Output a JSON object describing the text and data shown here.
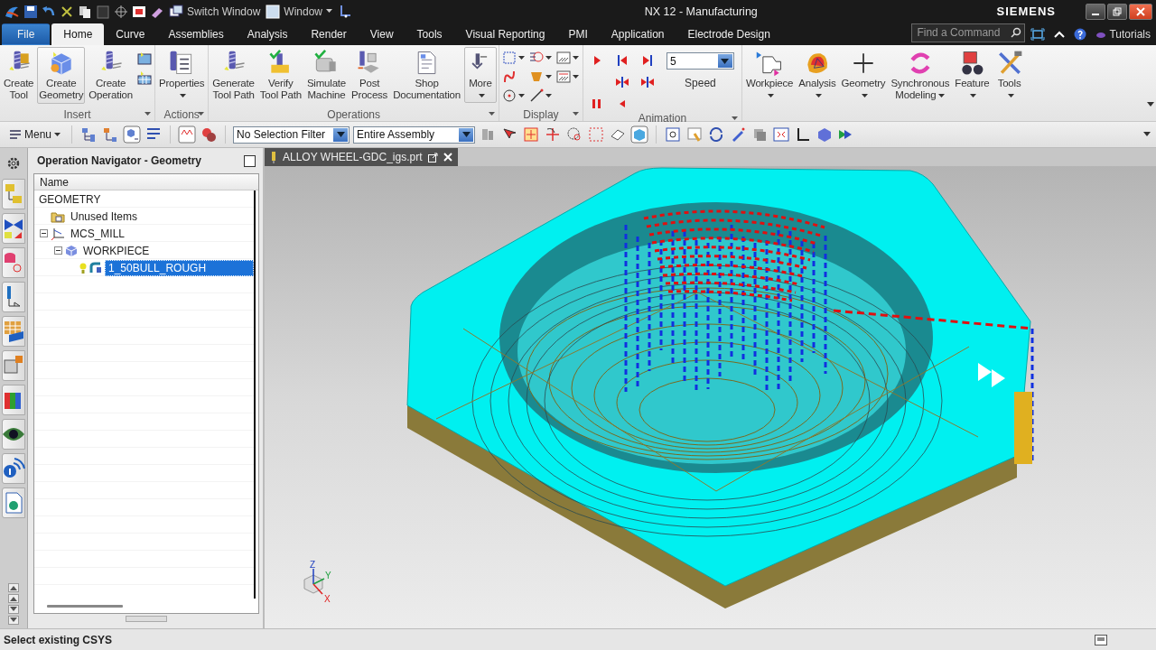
{
  "title_bar": {
    "quick_access": [
      {
        "label": "Switch Window",
        "kind": "switch"
      },
      {
        "label": "Window",
        "kind": "window"
      }
    ],
    "title": "NX 12 - Manufacturing",
    "brand": "SIEMENS"
  },
  "menu_tabs": [
    {
      "label": "File",
      "kind": "file",
      "selected": false
    },
    {
      "label": "Home",
      "kind": "tab",
      "selected": true
    },
    {
      "label": "Curve",
      "kind": "tab",
      "selected": false
    },
    {
      "label": "Assemblies",
      "kind": "tab",
      "selected": false
    },
    {
      "label": "Analysis",
      "kind": "tab",
      "selected": false
    },
    {
      "label": "Render",
      "kind": "tab",
      "selected": false
    },
    {
      "label": "View",
      "kind": "tab",
      "selected": false
    },
    {
      "label": "Tools",
      "kind": "tab",
      "selected": false
    },
    {
      "label": "Visual Reporting",
      "kind": "tab",
      "selected": false
    },
    {
      "label": "PMI",
      "kind": "tab",
      "selected": false
    },
    {
      "label": "Application",
      "kind": "tab",
      "selected": false
    },
    {
      "label": "Electrode Design",
      "kind": "tab",
      "selected": false
    }
  ],
  "search": {
    "placeholder": "Find a Command"
  },
  "help_link": "Tutorials",
  "ribbon": [
    {
      "kind": "buttons",
      "label": "Insert",
      "buttons": [
        {
          "label": "Create Tool",
          "active": false,
          "dropdown": false
        },
        {
          "label": "Create Geometry",
          "active": true,
          "dropdown": false
        },
        {
          "label": "Create Operation",
          "active": false,
          "dropdown": false
        }
      ]
    },
    {
      "kind": "buttons",
      "label": "Actions",
      "buttons": [
        {
          "label": "Properties",
          "active": false,
          "dropdown": true
        }
      ]
    },
    {
      "kind": "buttons",
      "label": "Operations",
      "buttons": [
        {
          "label": "Generate Tool Path",
          "active": false,
          "dropdown": false
        },
        {
          "label": "Verify Tool Path",
          "active": false,
          "dropdown": false
        },
        {
          "label": "Simulate Machine",
          "active": false,
          "dropdown": false
        },
        {
          "label": "Post Process",
          "active": false,
          "dropdown": false
        },
        {
          "label": "Shop Documentation",
          "active": false,
          "dropdown": false
        },
        {
          "label": "More",
          "active": true,
          "dropdown": true
        }
      ]
    },
    {
      "kind": "display",
      "label": "Display"
    },
    {
      "kind": "animation",
      "label": "Animation",
      "speed": {
        "value": "5",
        "label": "Speed"
      }
    },
    {
      "kind": "buttons",
      "buttons": [
        {
          "label": "Workpiece",
          "active": false,
          "dropdown": true
        },
        {
          "label": "Analysis",
          "active": false,
          "dropdown": true
        },
        {
          "label": "Geometry",
          "active": false,
          "dropdown": true
        },
        {
          "label": "Synchronous Modeling",
          "active": false,
          "dropdown": true
        },
        {
          "label": "Feature",
          "active": false,
          "dropdown": true
        },
        {
          "label": "Tools",
          "active": false,
          "dropdown": true
        }
      ]
    }
  ],
  "toolbar": {
    "menu": "Menu",
    "filters": [
      {
        "value": "No Selection Filter"
      },
      {
        "value": "Entire Assembly"
      }
    ]
  },
  "navigator": {
    "title": "Operation Navigator - Geometry",
    "column": "Name",
    "tree": [
      {
        "label": "GEOMETRY",
        "selected": false,
        "children": [
          {
            "label": "Unused Items",
            "kind": "folder",
            "selected": false
          },
          {
            "label": "MCS_MILL",
            "kind": "csys",
            "selected": false,
            "expanded": true,
            "children": [
              {
                "label": "WORKPIECE",
                "kind": "workpiece",
                "selected": false,
                "expanded": true,
                "children": [
                  {
                    "label": "1_50BULL_ROUGH",
                    "kind": "operation",
                    "selected": true
                  }
                ]
              }
            ]
          }
        ]
      }
    ]
  },
  "viewport": {
    "tab": "ALLOY WHEEL-GDC_igs.prt",
    "axes": [
      "Z",
      "Y",
      "X"
    ]
  },
  "status_bar": "Select existing CSYS"
}
